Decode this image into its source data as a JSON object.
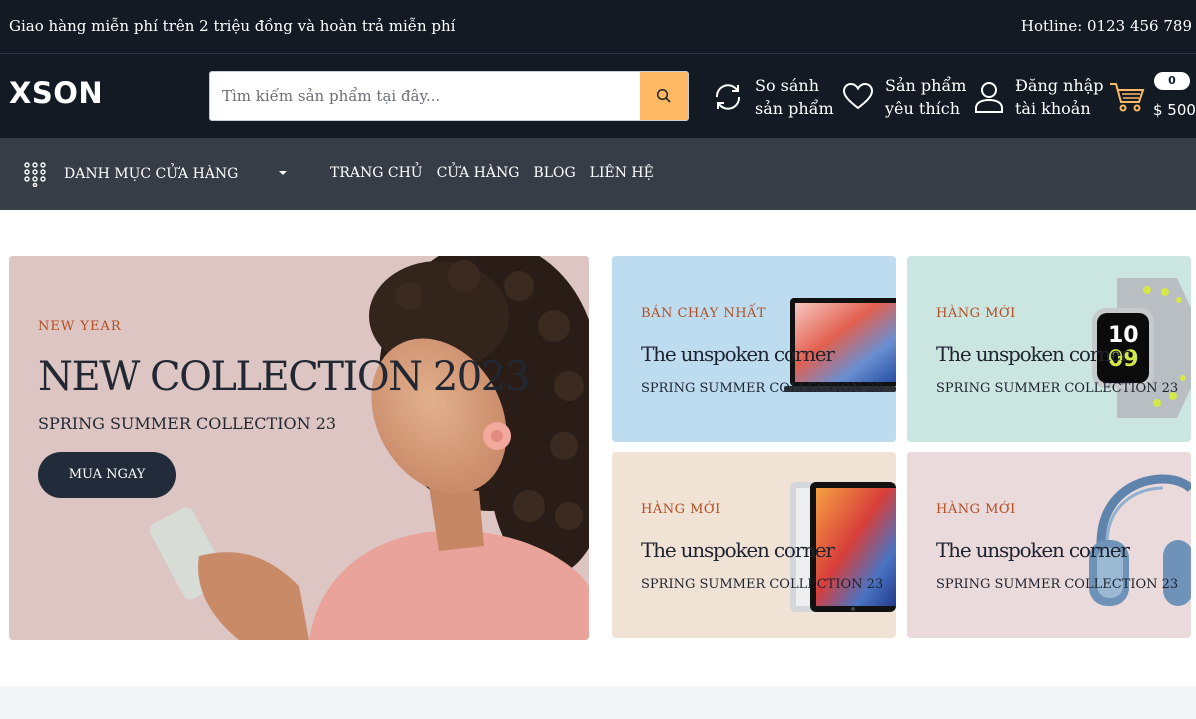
{
  "topbar": {
    "promo": "Giao hàng miễn phí trên 2 triệu đồng và hoàn trả miễn phí",
    "hotline": "Hotline: 0123 456 789"
  },
  "header": {
    "logo": "XSON",
    "search_placeholder": "Tìm kiếm sản phẩm tại đây...",
    "compare": {
      "line1": "So sánh",
      "line2": "sản phẩm"
    },
    "wishlist": {
      "line1": "Sản phẩm",
      "line2": "yêu thích"
    },
    "account": {
      "line1": "Đăng nhập",
      "line2": "tài khoản"
    },
    "cart": {
      "count": "0",
      "total": "$ 500"
    }
  },
  "nav": {
    "category_label": "DANH MỤC CỬA HÀNG",
    "links": [
      "TRANG CHỦ",
      "CỬA HÀNG",
      "BLOG",
      "LIÊN HỆ"
    ]
  },
  "hero": {
    "kicker": "NEW YEAR",
    "title": "NEW COLLECTION 2023",
    "subtitle": "SPRING SUMMER COLLECTION 23",
    "button": "MUA NGAY"
  },
  "cards": [
    {
      "kicker": "BÁN CHẠY NHẤT",
      "title": "The unspoken corner",
      "subtitle": "SPRING SUMMER COLLECTION 23",
      "bg": "#bddcef"
    },
    {
      "kicker": "HÀNG MỚI",
      "title": "The unspoken corner",
      "subtitle": "SPRING SUMMER COLLECTION 23",
      "bg": "#cbe5e0"
    },
    {
      "kicker": "HÀNG MỚI",
      "title": "The unspoken corner",
      "subtitle": "SPRING SUMMER COLLECTION 23",
      "bg": "#f0e3d5"
    },
    {
      "kicker": "HÀNG MỚI",
      "title": "The unspoken corner",
      "subtitle": "SPRING SUMMER COLLECTION 23",
      "bg": "#eadadb"
    }
  ],
  "colors": {
    "dark": "#131a24",
    "nav": "#373d46",
    "accent": "#fdb863",
    "kicker": "#b34d22",
    "hero_bg": "#dcc5c2"
  },
  "icons": [
    "search-icon",
    "compare-icon",
    "heart-icon",
    "user-icon",
    "cart-icon",
    "grid-dots-icon",
    "caret-down-icon"
  ]
}
